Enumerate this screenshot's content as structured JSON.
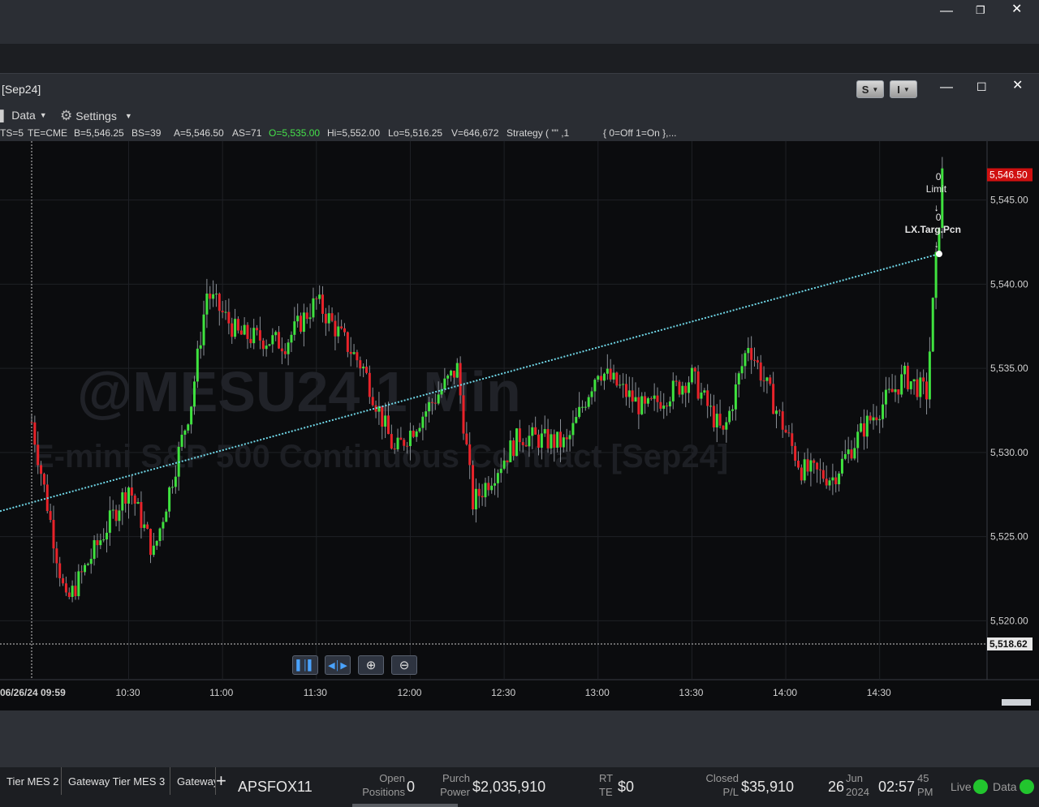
{
  "window": {
    "title": "[Sep24]",
    "toggle_s": "S",
    "toggle_i": "I"
  },
  "toolbar": {
    "data_label": "Data",
    "settings_label": "Settings"
  },
  "status_line": {
    "ts": "TS=5",
    "te": "TE=CME",
    "bid": "B=5,546.25",
    "bid_size": "BS=39",
    "ask": "A=5,546.50",
    "ask_size": "AS=71",
    "open": "O=5,535.00",
    "high": "Hi=5,552.00",
    "low": "Lo=5,516.25",
    "volume": "V=646,672",
    "strategy": "Strategy ( \"\" ,1",
    "toggle_info": "{ 0=Off 1=On },..."
  },
  "watermark": {
    "line1": "@MESU24 1 Min",
    "line2": "E-mini S&P 500 Continuous Contract [Sep24]"
  },
  "chart_data": {
    "type": "candlestick",
    "symbol": "@MESU24",
    "interval": "1 Min",
    "x_labels": [
      "06/26/24 09:59",
      "10:30",
      "11:00",
      "11:30",
      "12:00",
      "12:30",
      "13:00",
      "13:30",
      "14:00",
      "14:30"
    ],
    "y_ticks": [
      "5,520.00",
      "5,525.00",
      "5,530.00",
      "5,535.00",
      "5,540.00",
      "5,545.00"
    ],
    "ylim": [
      5516.5,
      5548.5
    ],
    "last_price": "5,546.50",
    "crosshair_price": "5,518.62",
    "key_points": [
      {
        "time": "09:59",
        "price": 5531.8
      },
      {
        "time": "10:10",
        "price": 5521.0
      },
      {
        "time": "10:30",
        "price": 5528.0
      },
      {
        "time": "10:38",
        "price": 5524.0
      },
      {
        "time": "10:50",
        "price": 5533.0
      },
      {
        "time": "10:55",
        "price": 5539.5
      },
      {
        "time": "11:05",
        "price": 5537.0
      },
      {
        "time": "11:20",
        "price": 5536.5
      },
      {
        "time": "11:30",
        "price": 5539.0
      },
      {
        "time": "11:45",
        "price": 5535.0
      },
      {
        "time": "11:55",
        "price": 5530.0
      },
      {
        "time": "12:15",
        "price": 5535.0
      },
      {
        "time": "12:20",
        "price": 5527.0
      },
      {
        "time": "12:35",
        "price": 5531.0
      },
      {
        "time": "12:50",
        "price": 5530.5
      },
      {
        "time": "13:00",
        "price": 5535.0
      },
      {
        "time": "13:15",
        "price": 5532.5
      },
      {
        "time": "13:30",
        "price": 5534.5
      },
      {
        "time": "13:40",
        "price": 5531.0
      },
      {
        "time": "13:48",
        "price": 5536.5
      },
      {
        "time": "14:05",
        "price": 5529.0
      },
      {
        "time": "14:15",
        "price": 5528.5
      },
      {
        "time": "14:25",
        "price": 5531.5
      },
      {
        "time": "14:38",
        "price": 5534.5
      },
      {
        "time": "14:45",
        "price": 5533.5
      },
      {
        "time": "14:50",
        "price": 5546.5
      }
    ],
    "trendline": {
      "start": {
        "time": "09:59",
        "price": 5526.8
      },
      "end": {
        "time": "14:49",
        "price": 5541.8
      }
    },
    "annotations": [
      "0",
      "Limit",
      "0",
      "LX.Targ.Pcn"
    ]
  },
  "status_bar": {
    "tabs": [
      "Tier MES 2",
      "Gateway Tier MES 3",
      "Gateway"
    ],
    "add_tab": "+",
    "account": "APSFOX11",
    "open_positions_label1": "Open",
    "open_positions_label2": "Positions",
    "open_positions_value": "0",
    "purch_power_label1": "Purch",
    "purch_power_label2": "Power",
    "purch_power_value": "$2,035,910",
    "rt_label1": "RT",
    "rt_label2": "TE",
    "rt_value": "$0",
    "closed_pl_label1": "Closed",
    "closed_pl_label2": "P/L",
    "closed_pl_value": "$35,910",
    "date_day": "26",
    "date_month": "Jun",
    "date_year": "2024",
    "time_hm": "02:57",
    "time_sec": "45",
    "time_ampm": "PM",
    "live_label": "Live",
    "data_label": "Data"
  },
  "colors": {
    "up": "#3fe23f",
    "down": "#e8232a",
    "trendline": "#6fd6e6",
    "last_price_bg": "#d01010"
  }
}
